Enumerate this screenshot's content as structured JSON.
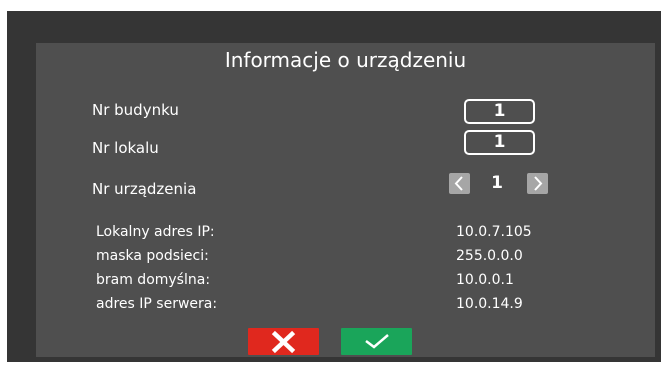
{
  "title": "Informacje o urządzeniu",
  "fields": {
    "building_label": "Nr budynku",
    "building_value": "1",
    "apartment_label": "Nr lokalu",
    "apartment_value": "1",
    "device_label": "Nr urządzenia",
    "device_value": "1"
  },
  "network": [
    {
      "label": "Lokalny adres IP:",
      "value": "10.0.7.105"
    },
    {
      "label": "maska podsieci:",
      "value": "255.0.0.0"
    },
    {
      "label": "bram domyślna:",
      "value": "10.0.0.1"
    },
    {
      "label": "adres IP serwera:",
      "value": "10.0.14.9"
    }
  ],
  "buttons": {
    "cancel_icon": "close-icon",
    "confirm_icon": "check-icon"
  },
  "colors": {
    "background_outer": "#353535",
    "panel": "#4f4f4f",
    "cancel": "#e0281e",
    "confirm": "#1aa55a",
    "arrow_bg": "#a6a6a6"
  }
}
